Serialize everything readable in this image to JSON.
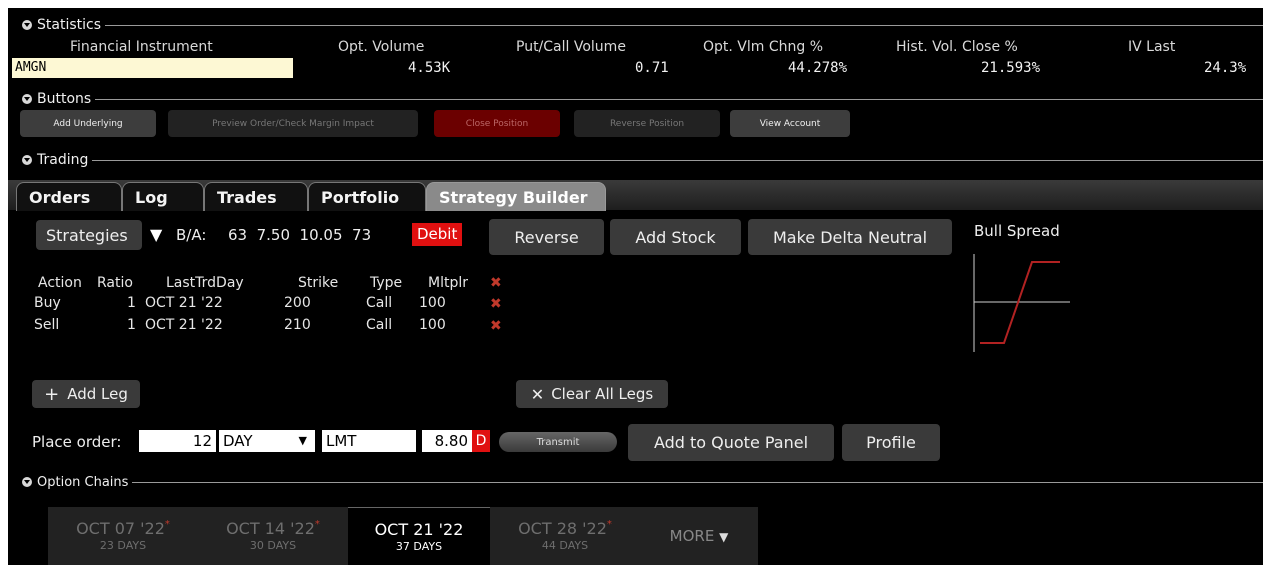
{
  "sections": {
    "statistics": "Statistics",
    "buttons": "Buttons",
    "trading": "Trading",
    "option_chains": "Option Chains"
  },
  "statistics": {
    "headers": [
      "Financial Instrument",
      "Opt. Volume",
      "Put/Call Volume",
      "Opt. Vlm Chng %",
      "Hist. Vol. Close %",
      "IV Last"
    ],
    "instrument": "AMGN",
    "values": [
      "4.53K",
      "0.71",
      "44.278%",
      "21.593%",
      "24.3%"
    ]
  },
  "buttons": {
    "add_underlying": "Add Underlying",
    "preview_order": "Preview Order/Check Margin Impact",
    "close_position": "Close Position",
    "reverse_position": "Reverse Position",
    "view_account": "View Account"
  },
  "tabs": [
    "Orders",
    "Log",
    "Trades",
    "Portfolio",
    "Strategy Builder"
  ],
  "strategy": {
    "strategies_label": "Strategies",
    "dropdown_glyph": "▼",
    "ba_label": "B/A:",
    "ba_values": "63  7.50  10.05  73",
    "debit_badge": "Debit",
    "reverse": "Reverse",
    "add_stock": "Add Stock",
    "make_delta_neutral": "Make Delta Neutral",
    "chart_title": "Bull Spread"
  },
  "legs": {
    "headers": [
      "Action",
      "Ratio",
      "LastTrdDay",
      "Strike",
      "Type",
      "Mltplr"
    ],
    "rows": [
      {
        "action": "Buy",
        "ratio": "1",
        "last": "OCT 21 '22",
        "strike": "200",
        "type": "Call",
        "mult": "100"
      },
      {
        "action": "Sell",
        "ratio": "1",
        "last": "OCT 21 '22",
        "strike": "210",
        "type": "Call",
        "mult": "100"
      }
    ],
    "remove_glyph": "✖",
    "add_leg": "Add Leg",
    "add_leg_glyph": "+",
    "clear_all": "Clear All Legs",
    "clear_glyph": "✕"
  },
  "order": {
    "place_label": "Place order:",
    "quantity": "12",
    "tif": "DAY",
    "order_type": "LMT",
    "price": "8.80",
    "price_flag": "D",
    "transmit": "Transmit",
    "add_to_quote": "Add to Quote Panel",
    "profile": "Profile"
  },
  "chains": [
    {
      "date": "OCT 07 '22",
      "days": "23 DAYS",
      "starred": true
    },
    {
      "date": "OCT 14 '22",
      "days": "30 DAYS",
      "starred": true
    },
    {
      "date": "OCT 21 '22",
      "days": "37 DAYS",
      "starred": false
    },
    {
      "date": "OCT 28 '22",
      "days": "44 DAYS",
      "starred": true
    }
  ],
  "chains_more": "MORE",
  "chains_more_glyph": "▼",
  "star_glyph": "*",
  "colors": {
    "debit": "#e01010",
    "remove_x": "#c0392b",
    "payoff_line": "#b22222",
    "close_position_bg": "#6b0000"
  },
  "icons": {
    "section_toggle": "collapse-triangle-icon",
    "remove_leg": "remove-x-icon",
    "add": "plus-icon",
    "clear": "close-icon",
    "dropdown": "chevron-down-icon"
  }
}
